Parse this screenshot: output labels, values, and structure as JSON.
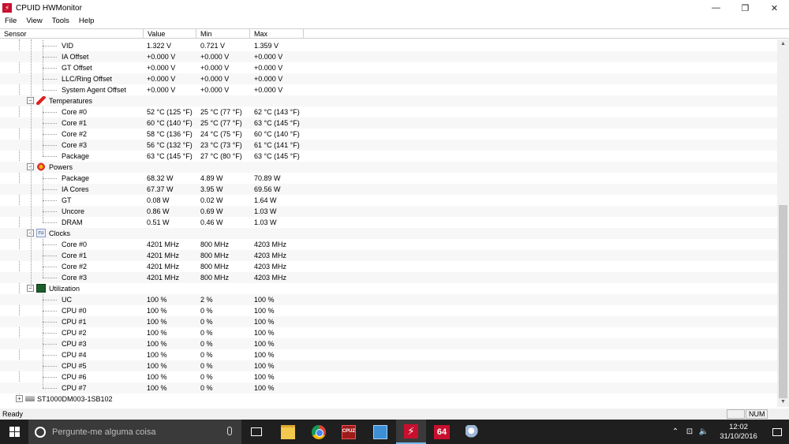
{
  "window": {
    "title": "CPUID HWMonitor",
    "minimize_glyph": "—",
    "maximize_glyph": "❐",
    "close_glyph": "✕"
  },
  "menu": [
    "File",
    "View",
    "Tools",
    "Help"
  ],
  "columns": {
    "sensor": "Sensor",
    "value": "Value",
    "min": "Min",
    "max": "Max"
  },
  "tree": [
    {
      "kind": "item",
      "label": "VID",
      "value": "1.322 V",
      "min": "0.721 V",
      "max": "1.359 V"
    },
    {
      "kind": "item",
      "label": "IA Offset",
      "value": "+0.000 V",
      "min": "+0.000 V",
      "max": "+0.000 V"
    },
    {
      "kind": "item",
      "label": "GT Offset",
      "value": "+0.000 V",
      "min": "+0.000 V",
      "max": "+0.000 V"
    },
    {
      "kind": "item",
      "label": "LLC/Ring Offset",
      "value": "+0.000 V",
      "min": "+0.000 V",
      "max": "+0.000 V"
    },
    {
      "kind": "item",
      "label": "System Agent Offset",
      "value": "+0.000 V",
      "min": "+0.000 V",
      "max": "+0.000 V"
    },
    {
      "kind": "group",
      "label": "Temperatures",
      "icon": "thermometer-icon"
    },
    {
      "kind": "item",
      "label": "Core #0",
      "value": "52 °C  (125 °F)",
      "min": "25 °C  (77 °F)",
      "max": "62 °C  (143 °F)"
    },
    {
      "kind": "item",
      "label": "Core #1",
      "value": "60 °C  (140 °F)",
      "min": "25 °C  (77 °F)",
      "max": "63 °C  (145 °F)"
    },
    {
      "kind": "item",
      "label": "Core #2",
      "value": "58 °C  (136 °F)",
      "min": "24 °C  (75 °F)",
      "max": "60 °C  (140 °F)"
    },
    {
      "kind": "item",
      "label": "Core #3",
      "value": "56 °C  (132 °F)",
      "min": "23 °C  (73 °F)",
      "max": "61 °C  (141 °F)"
    },
    {
      "kind": "item",
      "label": "Package",
      "value": "63 °C  (145 °F)",
      "min": "27 °C  (80 °F)",
      "max": "63 °C  (145 °F)"
    },
    {
      "kind": "group",
      "label": "Powers",
      "icon": "power-icon"
    },
    {
      "kind": "item",
      "label": "Package",
      "value": "68.32 W",
      "min": "4.89 W",
      "max": "70.89 W"
    },
    {
      "kind": "item",
      "label": "IA Cores",
      "value": "67.37 W",
      "min": "3.95 W",
      "max": "69.56 W"
    },
    {
      "kind": "item",
      "label": "GT",
      "value": "0.08 W",
      "min": "0.02 W",
      "max": "1.64 W"
    },
    {
      "kind": "item",
      "label": "Uncore",
      "value": "0.86 W",
      "min": "0.69 W",
      "max": "1.03 W"
    },
    {
      "kind": "item",
      "label": "DRAM",
      "value": "0.51 W",
      "min": "0.46 W",
      "max": "1.03 W"
    },
    {
      "kind": "group",
      "label": "Clocks",
      "icon": "clock-signal-icon"
    },
    {
      "kind": "item",
      "label": "Core #0",
      "value": "4201 MHz",
      "min": "800 MHz",
      "max": "4203 MHz"
    },
    {
      "kind": "item",
      "label": "Core #1",
      "value": "4201 MHz",
      "min": "800 MHz",
      "max": "4203 MHz"
    },
    {
      "kind": "item",
      "label": "Core #2",
      "value": "4201 MHz",
      "min": "800 MHz",
      "max": "4203 MHz"
    },
    {
      "kind": "item",
      "label": "Core #3",
      "value": "4201 MHz",
      "min": "800 MHz",
      "max": "4203 MHz"
    },
    {
      "kind": "group",
      "label": "Utilization",
      "icon": "utilization-icon"
    },
    {
      "kind": "item",
      "label": "UC",
      "value": "100 %",
      "min": "2 %",
      "max": "100 %"
    },
    {
      "kind": "item",
      "label": "CPU #0",
      "value": "100 %",
      "min": "0 %",
      "max": "100 %"
    },
    {
      "kind": "item",
      "label": "CPU #1",
      "value": "100 %",
      "min": "0 %",
      "max": "100 %"
    },
    {
      "kind": "item",
      "label": "CPU #2",
      "value": "100 %",
      "min": "0 %",
      "max": "100 %"
    },
    {
      "kind": "item",
      "label": "CPU #3",
      "value": "100 %",
      "min": "0 %",
      "max": "100 %"
    },
    {
      "kind": "item",
      "label": "CPU #4",
      "value": "100 %",
      "min": "0 %",
      "max": "100 %"
    },
    {
      "kind": "item",
      "label": "CPU #5",
      "value": "100 %",
      "min": "0 %",
      "max": "100 %"
    },
    {
      "kind": "item",
      "label": "CPU #6",
      "value": "100 %",
      "min": "0 %",
      "max": "100 %"
    },
    {
      "kind": "item",
      "label": "CPU #7",
      "value": "100 %",
      "min": "0 %",
      "max": "100 %"
    },
    {
      "kind": "device",
      "label": "ST1000DM003-1SB102",
      "icon": "hard-drive-icon"
    }
  ],
  "status": {
    "text": "Ready",
    "box1": "",
    "box2": "NUM"
  },
  "taskbar": {
    "search_placeholder": "Pergunte-me alguma coisa",
    "cpuz_label": "CPUZ",
    "aida_label": "64",
    "hwmon_label": "⚡",
    "tray_chevron": "⌃",
    "tray_network": "⊡",
    "tray_volume": "🔈",
    "time": "12:02",
    "date": "31/10/2016"
  },
  "colors": {
    "row_alt": "#f7f7f7",
    "taskbar": "#1f1f1f",
    "app_red": "#c8102e"
  }
}
